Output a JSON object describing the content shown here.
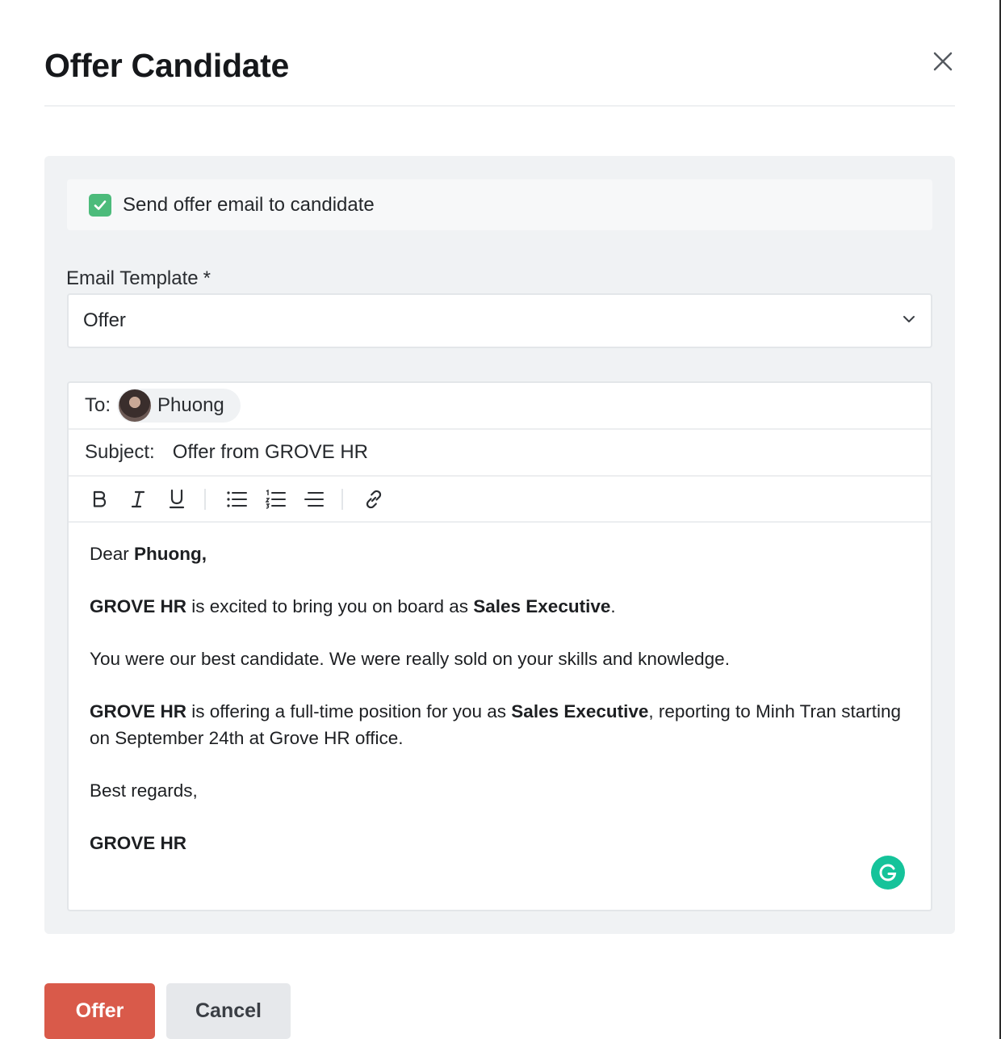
{
  "modal": {
    "title": "Offer Candidate",
    "close_icon": "close-icon"
  },
  "send_email": {
    "checked": true,
    "label": "Send offer email to candidate"
  },
  "email_template": {
    "label": "Email Template",
    "required_marker": "*",
    "value": "Offer",
    "icon": "chevron-down-icon"
  },
  "composer": {
    "to_label": "To:",
    "recipient": "Phuong",
    "subject_label": "Subject:",
    "subject_value": "Offer from GROVE HR",
    "toolbar": [
      "bold-icon",
      "italic-icon",
      "underline-icon",
      "bullet-list-icon",
      "numbered-list-icon",
      "align-icon",
      "link-icon"
    ],
    "body": {
      "greeting_prefix": "Dear ",
      "greeting_name": "Phuong,",
      "p1_company": "GROVE HR",
      "p1_text": " is excited to bring you on board as ",
      "p1_role": "Sales Executive",
      "p1_end": ".",
      "p2": "You were our best candidate. We were really sold on your skills and knowledge.",
      "p3_company": "GROVE HR",
      "p3_text": " is offering a full-time position for you as ",
      "p3_role": "Sales Executive",
      "p3_end": ", reporting to Minh Tran starting on September 24th at Grove HR office.",
      "closing": "Best regards,",
      "signature": "GROVE HR"
    }
  },
  "actions": {
    "offer_label": "Offer",
    "cancel_label": "Cancel"
  },
  "colors": {
    "accent_green": "#4cbb7b",
    "offer_red": "#d95a4a",
    "grammarly_green": "#15c39a"
  }
}
